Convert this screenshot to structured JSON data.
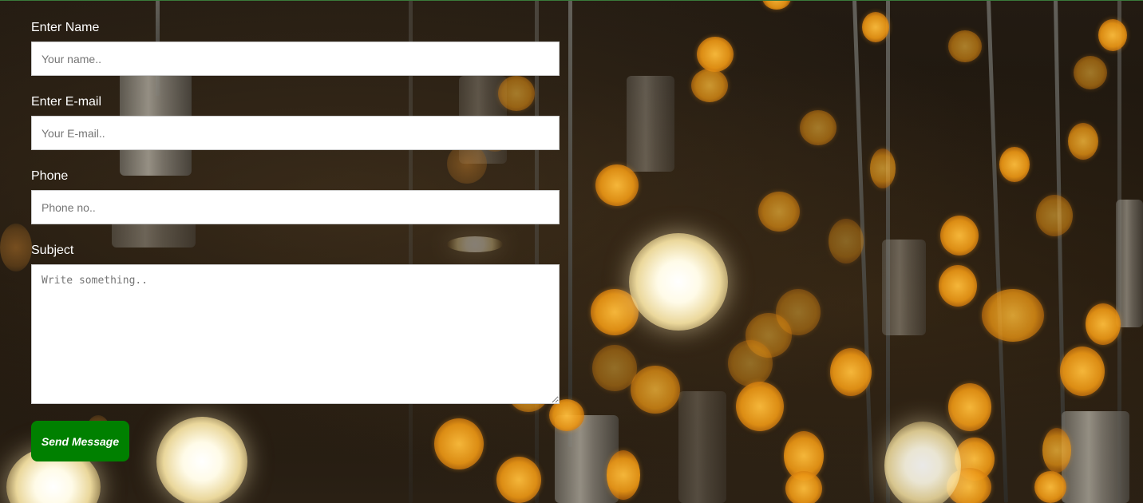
{
  "form": {
    "name_label": "Enter Name",
    "name_placeholder": "Your name..",
    "email_label": "Enter E-mail",
    "email_placeholder": "Your E-mail..",
    "phone_label": "Phone",
    "phone_placeholder": "Phone no..",
    "subject_label": "Subject",
    "subject_placeholder": "Write something..",
    "submit_label": "Send Message"
  },
  "colors": {
    "submit_button": "#008000",
    "label_text": "#ffffff",
    "field_background": "#ffffff"
  }
}
